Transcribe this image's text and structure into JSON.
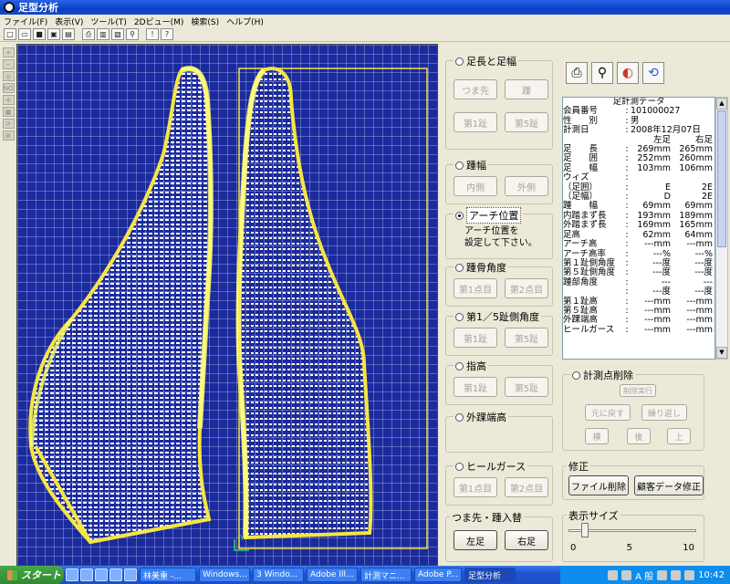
{
  "window": {
    "title": "足型分析"
  },
  "menu": [
    "ファイル(F)",
    "表示(V)",
    "ツール(T)",
    "2Dビュー(M)",
    "検索(S)",
    "ヘルプ(H)"
  ],
  "toolbar": {
    "icons": [
      "new-icon",
      "open-icon",
      "save-icon",
      "save-as-icon",
      "scan-icon",
      "print-icon",
      "preview-icon",
      "export-icon",
      "search-icon",
      "measure-icon",
      "help-icon"
    ]
  },
  "left_tools": {
    "icons": [
      "zoom-in-icon",
      "zoom-out-icon",
      "zoom-fit-icon",
      "no-icon",
      "move-icon",
      "grid-icon",
      "rotate-icon",
      "align-icon"
    ],
    "no_label": "NO"
  },
  "controls": {
    "foot_length_width": {
      "label": "足長と足幅",
      "buttons": [
        "つま先",
        "踵",
        "第1趾",
        "第5趾"
      ]
    },
    "heel_width": {
      "label": "踵幅",
      "buttons": [
        "内側",
        "外側"
      ]
    },
    "arch": {
      "label": "アーチ位置",
      "message": [
        "アーチ位置を",
        "設定して下さい。"
      ]
    },
    "heel_bone_angle": {
      "label": "踵骨角度",
      "buttons": [
        "第1点目",
        "第2点目"
      ]
    },
    "toe_angle": {
      "label": "第1／5趾側角度",
      "buttons": [
        "第1趾",
        "第5趾"
      ]
    },
    "toe_height": {
      "label": "指高",
      "buttons": [
        "第1趾",
        "第5趾"
      ]
    },
    "ankle": {
      "label": "外踝端高"
    },
    "heel_girth": {
      "label": "ヒールガース",
      "buttons": [
        "第1点目",
        "第2点目"
      ]
    },
    "swap": {
      "label": "つま先・踵入替",
      "buttons": [
        "左足",
        "右足"
      ]
    }
  },
  "data_panel": {
    "title": "足計測データ",
    "member_label": "会員番号",
    "member": "101000027",
    "gender_label": "性　　別",
    "gender": "男",
    "date_label": "計測日",
    "date": "2008年12月07日",
    "col_left": "左足",
    "col_right": "右足",
    "rows": [
      {
        "label": "足　　長",
        "left": "269mm",
        "right": "265mm"
      },
      {
        "label": "足　　囲",
        "left": "252mm",
        "right": "260mm"
      },
      {
        "label": "足　　幅",
        "left": "103mm",
        "right": "106mm"
      },
      {
        "label": "ウィズ",
        "left": "",
        "right": ""
      },
      {
        "label": "（足囲）",
        "left": "E",
        "right": "2E"
      },
      {
        "label": "（足幅）",
        "left": "D",
        "right": "2E"
      },
      {
        "label": "踵　　幅",
        "left": "69mm",
        "right": "69mm"
      },
      {
        "label": "内踏まず長",
        "left": "193mm",
        "right": "189mm"
      },
      {
        "label": "外踏まず長",
        "left": "169mm",
        "right": "165mm"
      },
      {
        "label": "足高",
        "left": "62mm",
        "right": "64mm"
      },
      {
        "label": "アーチ高",
        "left": "---mm",
        "right": "---mm"
      },
      {
        "label": "アーチ高率",
        "left": "---%",
        "right": "---%"
      },
      {
        "label": "第１趾側角度",
        "left": "---度",
        "right": "---度"
      },
      {
        "label": "第５趾側角度",
        "left": "---度",
        "right": "---度"
      },
      {
        "label": "踵部角度",
        "left": "---",
        "right": "---"
      },
      {
        "label": "",
        "left": "---度",
        "right": "---度"
      },
      {
        "label": "第１趾高",
        "left": "---mm",
        "right": "---mm"
      },
      {
        "label": "第５趾高",
        "left": "---mm",
        "right": "---mm"
      },
      {
        "label": "外踝端高",
        "left": "---mm",
        "right": "---mm"
      },
      {
        "label": "ヒールガース",
        "left": "---mm",
        "right": "---mm"
      }
    ]
  },
  "point_delete": {
    "label": "計測点削除",
    "exec": "削除実行",
    "undo": "元に戻す",
    "redo": "繰り返し",
    "arrows": [
      "横",
      "後",
      "上"
    ]
  },
  "edit": {
    "label": "修正",
    "file_delete": "ファイル削除",
    "customer_edit": "顧客データ修正"
  },
  "display_size": {
    "label": "表示サイズ",
    "min": "0",
    "mid": "5",
    "max": "10",
    "value": 1
  },
  "canvas": {
    "corner_label": "Y"
  },
  "taskbar": {
    "start": "スタート",
    "tasks": [
      "林美重 -...",
      "Windows...",
      "3 Windo...",
      "Adobe Ill...",
      "計測マニ...",
      "Adobe P...",
      "足型分析"
    ],
    "ime": "A 般",
    "clock": "10:42"
  }
}
